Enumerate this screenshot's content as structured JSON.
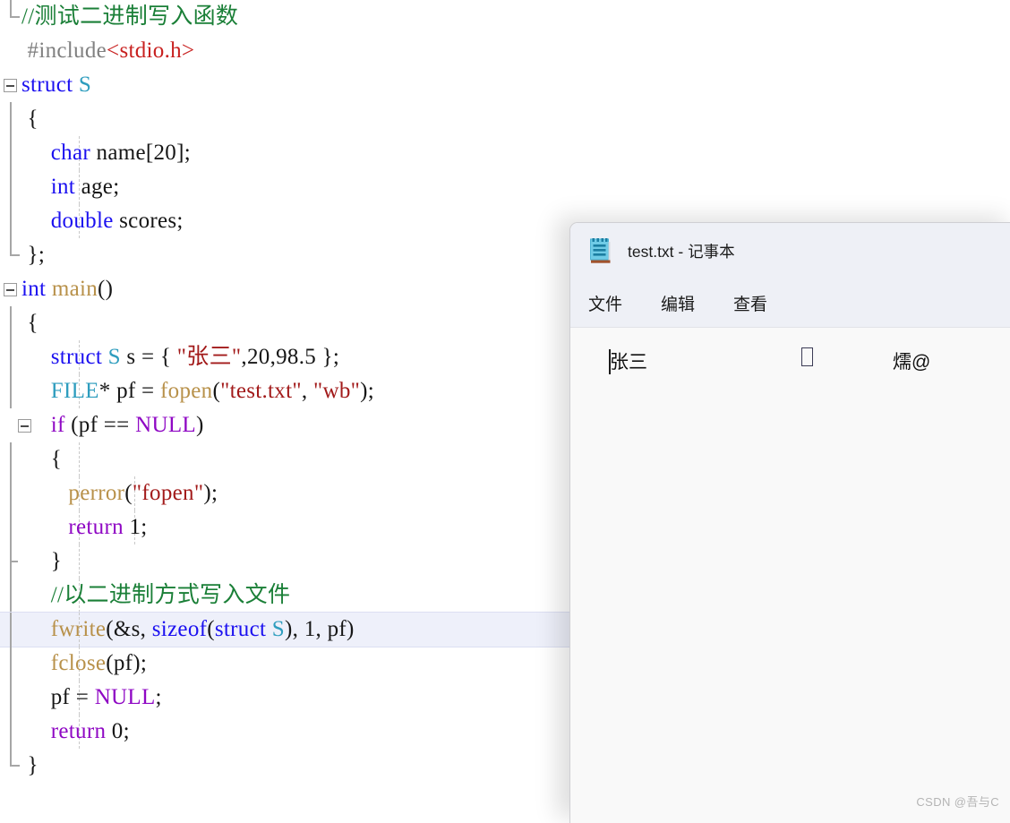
{
  "editor": {
    "name": "visual-studio-code-editor",
    "clipped_top_text": "//}",
    "colors": {
      "comment": "#1a7f37",
      "preprocessor": "#808080",
      "include_path": "#c8201f",
      "keyword": "#1b10f0",
      "control_keyword": "#8f08c4",
      "type": "#2e9dbe",
      "function": "#b8914a",
      "string": "#a21a1a",
      "plain": "#161616",
      "highlight_background": "#eef0fa"
    },
    "lines": [
      {
        "id": "l1",
        "gutter": "end-bracket",
        "tokens": [
          {
            "t": "//测试二进制写入函数",
            "c": "c-comment"
          }
        ]
      },
      {
        "id": "l2",
        "gutter": "none",
        "tokens": [
          {
            "t": " #include",
            "c": "c-pre"
          },
          {
            "t": "<stdio.h>",
            "c": "c-inc"
          }
        ]
      },
      {
        "id": "l3",
        "gutter": "fold-open",
        "tokens": [
          {
            "t": "struct ",
            "c": "c-kw"
          },
          {
            "t": "S",
            "c": "c-type"
          }
        ]
      },
      {
        "id": "l4",
        "gutter": "bar",
        "tokens": [
          {
            "t": " {",
            "c": "c-plain"
          }
        ]
      },
      {
        "id": "l5",
        "gutter": "bar-guide",
        "tokens": [
          {
            "t": "     char",
            "c": "c-kw"
          },
          {
            "t": " name[20];",
            "c": "c-plain"
          }
        ]
      },
      {
        "id": "l6",
        "gutter": "bar-guide",
        "tokens": [
          {
            "t": "     int",
            "c": "c-kw"
          },
          {
            "t": " age;",
            "c": "c-plain"
          }
        ]
      },
      {
        "id": "l7",
        "gutter": "bar-guide",
        "tokens": [
          {
            "t": "     double",
            "c": "c-kw"
          },
          {
            "t": " scores;",
            "c": "c-plain"
          }
        ]
      },
      {
        "id": "l8",
        "gutter": "bar-end",
        "tokens": [
          {
            "t": " };",
            "c": "c-plain"
          }
        ]
      },
      {
        "id": "l9",
        "gutter": "fold-open",
        "tokens": [
          {
            "t": "int",
            "c": "c-kw"
          },
          {
            "t": " main",
            "c": "c-fn"
          },
          {
            "t": "()",
            "c": "c-plain"
          }
        ]
      },
      {
        "id": "l10",
        "gutter": "bar",
        "tokens": [
          {
            "t": " {",
            "c": "c-plain"
          }
        ]
      },
      {
        "id": "l11",
        "gutter": "bar-guide",
        "tokens": [
          {
            "t": "     struct",
            "c": "c-kw"
          },
          {
            "t": " S",
            "c": "c-type"
          },
          {
            "t": " s = { ",
            "c": "c-plain"
          },
          {
            "t": "\"张三\"",
            "c": "c-str"
          },
          {
            "t": ",20,98.5 };",
            "c": "c-plain"
          }
        ]
      },
      {
        "id": "l12",
        "gutter": "bar-guide",
        "tokens": [
          {
            "t": "     FILE",
            "c": "c-type"
          },
          {
            "t": "* pf = ",
            "c": "c-plain"
          },
          {
            "t": "fopen",
            "c": "c-fn"
          },
          {
            "t": "(",
            "c": "c-plain"
          },
          {
            "t": "\"test.txt\"",
            "c": "c-str"
          },
          {
            "t": ", ",
            "c": "c-plain"
          },
          {
            "t": "\"wb\"",
            "c": "c-str"
          },
          {
            "t": ");",
            "c": "c-plain"
          }
        ]
      },
      {
        "id": "l13",
        "gutter": "fold-open-2",
        "tokens": [
          {
            "t": "     if",
            "c": "c-kw2"
          },
          {
            "t": " (pf == ",
            "c": "c-plain"
          },
          {
            "t": "NULL",
            "c": "c-kw2"
          },
          {
            "t": ")",
            "c": "c-plain"
          }
        ]
      },
      {
        "id": "l14",
        "gutter": "bar2",
        "tokens": [
          {
            "t": "     {",
            "c": "c-plain"
          }
        ]
      },
      {
        "id": "l15",
        "gutter": "bar2-guide",
        "tokens": [
          {
            "t": "        perror",
            "c": "c-fn"
          },
          {
            "t": "(",
            "c": "c-plain"
          },
          {
            "t": "\"fopen\"",
            "c": "c-str"
          },
          {
            "t": ");",
            "c": "c-plain"
          }
        ]
      },
      {
        "id": "l16",
        "gutter": "bar2-guide",
        "tokens": [
          {
            "t": "        return",
            "c": "c-kw2"
          },
          {
            "t": " 1;",
            "c": "c-plain"
          }
        ]
      },
      {
        "id": "l17",
        "gutter": "bar2-end",
        "tokens": [
          {
            "t": "     }",
            "c": "c-plain"
          }
        ]
      },
      {
        "id": "l18",
        "gutter": "bar-guide",
        "tokens": [
          {
            "t": "     //以二进制方式写入文件",
            "c": "c-comment"
          }
        ]
      },
      {
        "id": "l19",
        "gutter": "bar-guide",
        "highlight": true,
        "tokens": [
          {
            "t": "     fwrite",
            "c": "c-fn"
          },
          {
            "t": "(&s, ",
            "c": "c-plain"
          },
          {
            "t": "sizeof",
            "c": "c-kw"
          },
          {
            "t": "(",
            "c": "c-plain"
          },
          {
            "t": "struct",
            "c": "c-kw"
          },
          {
            "t": " S",
            "c": "c-type"
          },
          {
            "t": "), 1, pf)",
            "c": "c-plain"
          }
        ]
      },
      {
        "id": "l20",
        "gutter": "bar-guide",
        "tokens": [
          {
            "t": "     fclose",
            "c": "c-fn"
          },
          {
            "t": "(pf);",
            "c": "c-plain"
          }
        ]
      },
      {
        "id": "l21",
        "gutter": "bar-guide",
        "tokens": [
          {
            "t": "     pf = ",
            "c": "c-plain"
          },
          {
            "t": "NULL",
            "c": "c-kw2"
          },
          {
            "t": ";",
            "c": "c-plain"
          }
        ]
      },
      {
        "id": "l22",
        "gutter": "bar-guide",
        "tokens": [
          {
            "t": "     return",
            "c": "c-kw2"
          },
          {
            "t": " 0;",
            "c": "c-plain"
          }
        ]
      },
      {
        "id": "l23",
        "gutter": "bar-end",
        "tokens": [
          {
            "t": " }",
            "c": "c-plain"
          }
        ]
      }
    ]
  },
  "notepad": {
    "window_title": "test.txt - 记事本",
    "icon": "notepad-icon",
    "menu": [
      {
        "label": "文件"
      },
      {
        "label": "编辑"
      },
      {
        "label": "查看"
      }
    ],
    "content": {
      "segment_name": "张三",
      "segment_tofu": "□",
      "segment_garbled": "燸@"
    }
  },
  "watermark": {
    "text": "CSDN @吾与C"
  }
}
